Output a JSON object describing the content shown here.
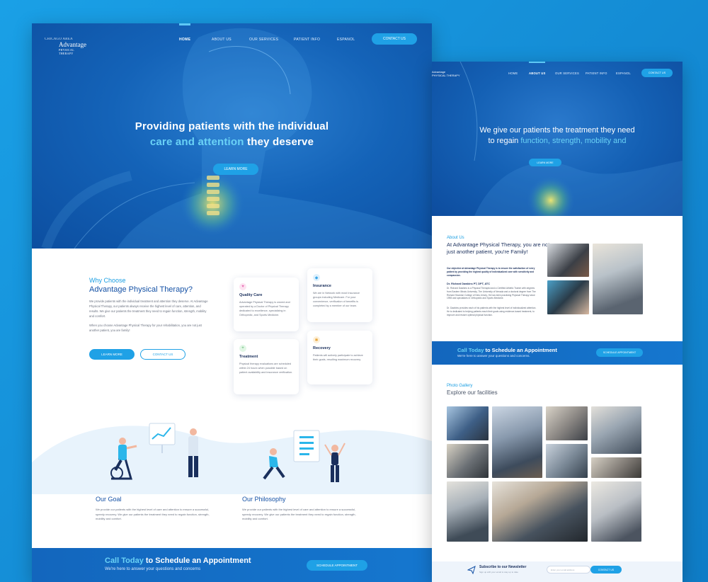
{
  "left": {
    "logo": {
      "line1": "CHICAGO AREA",
      "line2": "Advantage",
      "line3": "PHYSICAL THERAPY"
    },
    "nav": {
      "items": [
        {
          "label": "HOME",
          "active": true
        },
        {
          "label": "ABOUT US",
          "active": false
        },
        {
          "label": "OUR SERVICES",
          "active": false
        },
        {
          "label": "PATIENT INFO",
          "active": false
        },
        {
          "label": "ESPANOL",
          "active": false
        }
      ],
      "contact_label": "CONTACT US"
    },
    "hero": {
      "line1": "Providing patients with the individual",
      "line2_highlight": "care and attention",
      "line2_rest": " they deserve",
      "button": "LEARN MORE"
    },
    "why": {
      "subtitle": "Why Choose",
      "title": "Advantage Physical Therapy?",
      "body1": "We provide patients with the individual treatment and attention they deserve. At Advantage Physical Therapy, our patients always receive the highest level of care, attention, and results. We give our patients the treatment they need to regain function, strength, mobility and comfort.",
      "body2": "When you choose Advantage Physical Therapy for your rehabilitation, you are not just another patient, you are family!",
      "learn_more": "LEARN MORE",
      "contact_us": "CONTACT US"
    },
    "cards": [
      {
        "title": "Quality Care",
        "text": "Advantage Physical Therapy is owned and operated by a Doctor of Physical Therapy dedicated to excellence, specializing in Orthopedic, and Sports Medicine.",
        "icon": "heart-icon",
        "color": "#f2a3d3"
      },
      {
        "title": "Insurance",
        "text": "We are in Network with most Insurance groups including Medicare. For your convenience, verification of benefits is completed by a member of our team.",
        "icon": "shield-icon",
        "color": "#7ec7f2"
      },
      {
        "title": "Treatment",
        "text": "Physical therapy evaluations are scheduled within 24 hours when possible based on patient availability and insurance verification.",
        "icon": "plus-icon",
        "color": "#8fd49a"
      },
      {
        "title": "Recovery",
        "text": "Patients will actively participate to achieve their goals, resulting maximum recovery.",
        "icon": "star-icon",
        "color": "#f5c26b"
      }
    ],
    "goal": {
      "title": "Our Goal",
      "text": "We provide our patients with the highest level of care and attention to ensure a successful, speedy recovery. We give our patients the treatment they need to regain function, strength, mobility and comfort."
    },
    "philosophy": {
      "title": "Our Philosophy",
      "text": "We provide our patients with the highest level of care and attention to ensure a successful, speedy recovery. We give our patients the treatment they need to regain function, strength, mobility and comfort."
    },
    "call": {
      "highlight": "Call Today",
      "rest": " to Schedule an Appointment",
      "subtitle": "We're here to answer your questions and concerns",
      "button": "SCHEDULE APPOINTMENT"
    }
  },
  "right": {
    "logo": {
      "line1": "Advantage",
      "line2": "PHYSICAL THERAPY"
    },
    "nav": {
      "items": [
        {
          "label": "HOME",
          "active": false
        },
        {
          "label": "ABOUT US",
          "active": true
        },
        {
          "label": "OUR SERVICES",
          "active": false
        },
        {
          "label": "PATIENT INFO",
          "active": false
        },
        {
          "label": "ESPANOL",
          "active": false
        }
      ],
      "contact_label": "CONTACT US"
    },
    "hero": {
      "line1": "We give our patients the treatment they need",
      "line2_pre": "to regain ",
      "line2_highlight": "function, strength, mobility and",
      "button": "LEARN MORE"
    },
    "about": {
      "subtitle": "About Us",
      "title": "At Advantage Physical Therapy, you are not just another patient, you're Family!",
      "intro": "Our objective at Advantage Physical Therapy is to ensure the satisfaction of every patient by providing the highest quality of individualized care with sensitivity and compassion.",
      "name": "Dr. Richard Dawkins PT, DPT, ATC",
      "bio1": "Dr. Richard Dawkins is a Physical Therapist and a Certified Athletic Trainer with degrees from Eastern Illinois University, The University of Nevada and a doctoral degree from The Richard Stockton College of New Jersey. He has been practicing Physical Therapy since 1998 and specializes in Orthopedic and Sports Medicine.",
      "bio2": "Dr. Dawkins provides each of his patients with the highest level of individualized attention. He is dedicated to helping patients reach their goals using evidence-based treatment, to improve and restore optimal physical function."
    },
    "call": {
      "highlight": "Call Today",
      "rest": " to Schedule an Appointment",
      "subtitle": "We're here to answer your questions and concerns.",
      "button": "SCHEDULE APPOINTMENT"
    },
    "gallery": {
      "subtitle": "Photo Gallery",
      "title": "Explore our facilities"
    },
    "newsletter": {
      "title": "Subscribe to our Newsletter",
      "subtitle": "Sign up with your email to stay up to date",
      "placeholder": "Enter your email address",
      "button": "CONTACT US"
    }
  }
}
